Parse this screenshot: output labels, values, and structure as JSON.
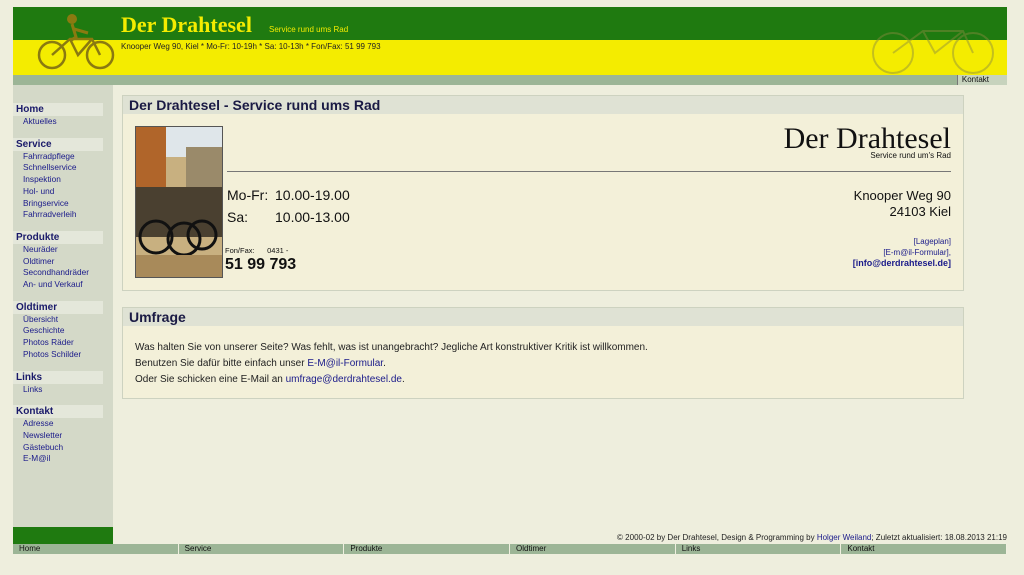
{
  "header": {
    "title": "Der Drahtesel",
    "tagline": "Service rund ums Rad",
    "info": "Knooper Weg 90, Kiel * Mo-Fr: 10-19h * Sa: 10-13h * Fon/Fax: 51 99 793"
  },
  "topbar": {
    "kontakt": "Kontakt"
  },
  "sidebar": {
    "groups": [
      {
        "head": "Home",
        "items": [
          "Aktuelles"
        ]
      },
      {
        "head": "Service",
        "items": [
          "Fahrradpflege",
          "Schnellservice",
          "Inspektion",
          "Hol- und",
          "Bringservice",
          "Fahrradverleih"
        ]
      },
      {
        "head": "Produkte",
        "items": [
          "Neuräder",
          "Oldtimer",
          "Secondhandräder",
          "An- und Verkauf"
        ]
      },
      {
        "head": "Oldtimer",
        "items": [
          "Übersicht",
          "Geschichte",
          "Photos Räder",
          "Photos Schilder"
        ]
      },
      {
        "head": "Links",
        "items": [
          "Links"
        ]
      },
      {
        "head": "Kontakt",
        "items": [
          "Adresse",
          "Newsletter",
          "Gästebuch",
          "E-M@il"
        ]
      }
    ]
  },
  "main": {
    "box1": {
      "heading": "Der Drahtesel - Service rund ums Rad",
      "store_name": "Der Drahtesel",
      "store_sub": "Service rund um's Rad",
      "hours": [
        {
          "day": "Mo-Fr:",
          "time": "10.00-19.00"
        },
        {
          "day": "Sa:",
          "time": "10.00-13.00"
        }
      ],
      "fon_label": "Fon/Fax:      0431 -",
      "fon_number": "51 99 793",
      "street": "Knooper Weg 90",
      "city": "24103 Kiel",
      "lageplan": "[Lageplan]",
      "formular": "[E-m@il-Formular],",
      "email": "[info@derdrahtesel.de]"
    },
    "box2": {
      "heading": "Umfrage",
      "line1": "Was halten Sie von unserer Seite? Was fehlt, was ist unangebracht? Jegliche Art konstruktiver Kritik ist willkommen.",
      "line2_pre": "Benutzen Sie dafür bitte einfach unser ",
      "line2_link": "E-M@il-Formular",
      "line2_post": ".",
      "line3_pre": "Oder Sie schicken eine E-Mail an ",
      "line3_link": "umfrage@derdrahtesel.de",
      "line3_post": "."
    }
  },
  "footer": {
    "copyright_pre": "© 2000-02 by Der Drahtesel, Design & Programming by ",
    "copyright_link": "Holger Weiland",
    "copyright_post": "; Zuletzt aktualisiert: 18.08.2013 21:19",
    "nav": [
      "Home",
      "Service",
      "Produkte",
      "Oldtimer",
      "Links",
      "Kontakt"
    ]
  }
}
